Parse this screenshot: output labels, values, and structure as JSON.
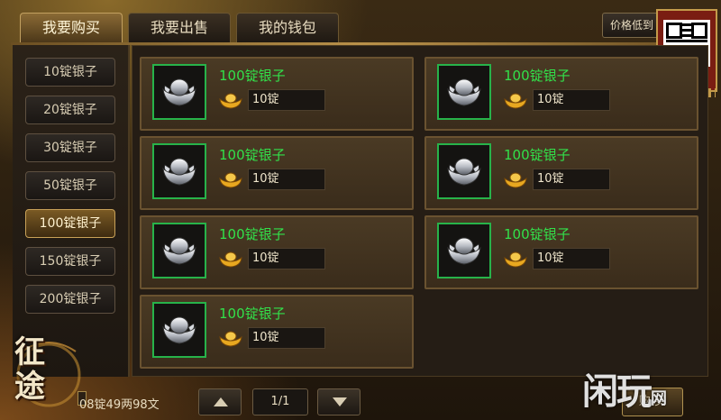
{
  "tabs": [
    {
      "label": "我要购买",
      "active": true
    },
    {
      "label": "我要出售",
      "active": false
    },
    {
      "label": "我的钱包",
      "active": false
    }
  ],
  "sort_button": {
    "label": "价格低到"
  },
  "categories": [
    {
      "label": "10锭银子",
      "active": false
    },
    {
      "label": "20锭银子",
      "active": false
    },
    {
      "label": "30锭银子",
      "active": false
    },
    {
      "label": "50锭银子",
      "active": false
    },
    {
      "label": "100锭银子",
      "active": true
    },
    {
      "label": "150锭银子",
      "active": false
    },
    {
      "label": "200锭银子",
      "active": false
    }
  ],
  "items": [
    {
      "name": "100锭银子",
      "price": "10锭",
      "icon": "silver-ingot-icon"
    },
    {
      "name": "100锭银子",
      "price": "10锭",
      "icon": "silver-ingot-icon"
    },
    {
      "name": "100锭银子",
      "price": "10锭",
      "icon": "silver-ingot-icon"
    },
    {
      "name": "100锭银子",
      "price": "10锭",
      "icon": "silver-ingot-icon"
    },
    {
      "name": "100锭银子",
      "price": "10锭",
      "icon": "silver-ingot-icon"
    },
    {
      "name": "100锭银子",
      "price": "10锭",
      "icon": "silver-ingot-icon"
    },
    {
      "name": "100锭银子",
      "price": "10锭",
      "icon": "silver-ingot-icon"
    }
  ],
  "footer": {
    "money": "08锭49两98文",
    "page": "1/1",
    "buy_label": "购 买"
  },
  "logo": {
    "text": "征途"
  },
  "watermark": {
    "text": "闲玩",
    "suffix": "网"
  },
  "colors": {
    "item_name": "#32e04a",
    "icon_border": "#27b34a",
    "accent_gold": "#c8a158"
  }
}
